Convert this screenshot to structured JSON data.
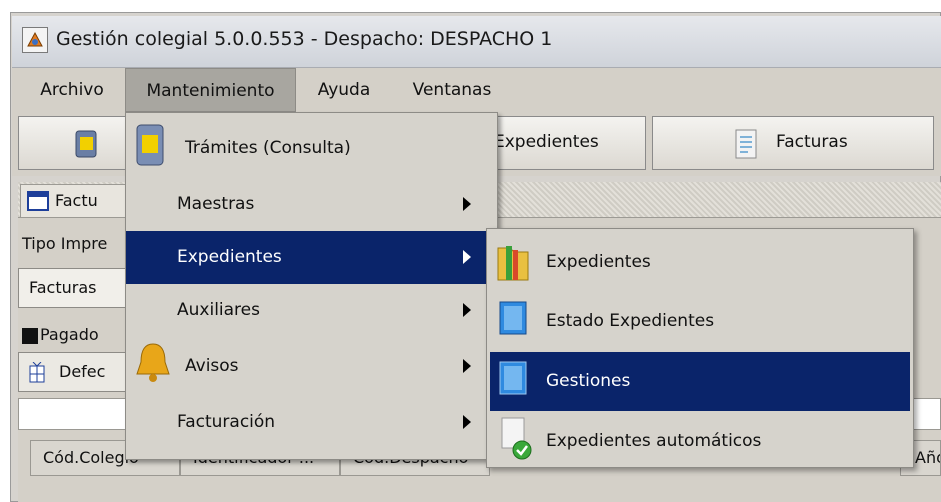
{
  "window": {
    "title": "Gestión colegial 5.0.0.553 - Despacho: DESPACHO 1"
  },
  "menubar": {
    "items": [
      "Archivo",
      "Mantenimiento",
      "Ayuda",
      "Ventanas"
    ]
  },
  "toolbar": {
    "expedientes_label": "Expedientes",
    "facturas_label": "Facturas"
  },
  "panel": {
    "tab_label": "Factu",
    "tipo_label": "Tipo Impre",
    "combo_value": "Facturas",
    "pagado_label": "Pagado",
    "defecto_label": "Defec",
    "columns": [
      "Cód.Colegio",
      "Identificador ...",
      "Cód.Despacho",
      "Año"
    ]
  },
  "menu": {
    "items": [
      {
        "label": "Trámites (Consulta)",
        "icon": "tramites-icon",
        "submenu": false
      },
      {
        "label": "Maestras",
        "submenu": true
      },
      {
        "label": "Expedientes",
        "submenu": true,
        "selected": true
      },
      {
        "label": "Auxiliares",
        "submenu": true
      },
      {
        "label": "Avisos",
        "icon": "bell-icon",
        "submenu": true
      },
      {
        "label": "Facturación",
        "submenu": true
      }
    ]
  },
  "submenu": {
    "items": [
      {
        "label": "Expedientes",
        "icon": "folder-icon"
      },
      {
        "label": "Estado Expedientes",
        "icon": "window-icon"
      },
      {
        "label": "Gestiones",
        "icon": "window-icon",
        "selected": true
      },
      {
        "label": "Expedientes automáticos",
        "icon": "document-check-icon"
      }
    ]
  },
  "colors": {
    "selection": "#0a246a",
    "menu_bg": "#d6d3cc"
  }
}
